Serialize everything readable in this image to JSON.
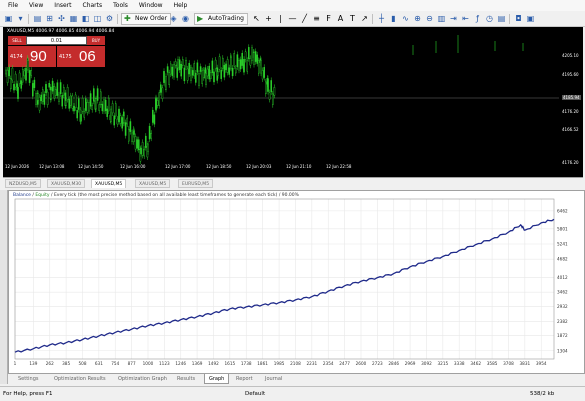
{
  "menu": [
    "File",
    "View",
    "Insert",
    "Charts",
    "Tools",
    "Window",
    "Help"
  ],
  "toolbar": {
    "new_order_label": "New Order",
    "autotrading_label": "AutoTrading"
  },
  "chart": {
    "title": "XAUUSD,M5  4006.97 4006.85 4006.94 4006.84",
    "trade_panel": {
      "sell_label": "SELL",
      "buy_label": "BUY",
      "lot_value": "0.01",
      "sell_small": "4174",
      "sell_big": "90",
      "buy_small": "4175",
      "buy_big": "06"
    },
    "price_labels": [
      "4205.10",
      "4195.60",
      "4185.94",
      "4176.20",
      "4166.52",
      "4176.20"
    ],
    "current_price": "4185.94",
    "time_labels": [
      "12 Jun 2026",
      "12 Jun 13:08",
      "12 Jun 14:50",
      "12 Jun 16:00",
      "12 Jun 17:00",
      "12 Jun 18:50",
      "12 Jun 20:03",
      "12 Jun 21:10",
      "12 Jun 22:58"
    ]
  },
  "symbol_tabs": [
    "NZDUSD,M5",
    "XAUUSD,M30",
    "XAUUSD,M5",
    "XAUUSD,M5",
    "EURUSD,M5"
  ],
  "active_symbol_tab": 2,
  "graph": {
    "legend_balance": "Balance",
    "legend_equity": "Equity",
    "legend_text": "Every tick (the most precise method based on all available least timeframes to generate each tick) / 90.00%",
    "line_color": "#1f2a8a",
    "y_labels": [
      "6462",
      "5801",
      "5241",
      "4682",
      "4012",
      "3462",
      "2932",
      "2382",
      "1872",
      "1304"
    ],
    "x_labels": [
      "1",
      "139",
      "262",
      "385",
      "508",
      "631",
      "754",
      "877",
      "1000",
      "1123",
      "1246",
      "1369",
      "1492",
      "1615",
      "1738",
      "1861",
      "1985",
      "2108",
      "2231",
      "2354",
      "2477",
      "2600",
      "2723",
      "2846",
      "2969",
      "3092",
      "3215",
      "3338",
      "3462",
      "3585",
      "3708",
      "3831",
      "3954"
    ]
  },
  "chart_data": {
    "type": "line",
    "title": "",
    "xlabel": "",
    "ylabel": "",
    "xlim": [
      1,
      4050
    ],
    "ylim": [
      1000,
      6900
    ],
    "series": [
      {
        "name": "Balance",
        "x": [
          1,
          139,
          262,
          385,
          508,
          631,
          754,
          877,
          1000,
          1123,
          1246,
          1369,
          1492,
          1615,
          1738,
          1861,
          1985,
          2108,
          2231,
          2354,
          2477,
          2600,
          2723,
          2846,
          2969,
          3092,
          3215,
          3338,
          3462,
          3585,
          3708,
          3800,
          3831,
          3954,
          4050
        ],
        "values": [
          1250,
          1380,
          1520,
          1600,
          1720,
          1850,
          1980,
          2100,
          2230,
          2330,
          2450,
          2560,
          2700,
          2850,
          2920,
          3000,
          3080,
          3180,
          3300,
          3500,
          3700,
          3870,
          4000,
          4150,
          4400,
          4600,
          4780,
          5000,
          5220,
          5430,
          5680,
          5950,
          5750,
          6020,
          6150
        ]
      }
    ]
  },
  "bottom_tabs": [
    "Settings",
    "Optimization Results",
    "Optimization Graph",
    "Results",
    "Graph",
    "Report",
    "Journal"
  ],
  "active_bottom_tab": 4,
  "status": {
    "help": "For Help, press F1",
    "profile": "Default",
    "traffic": "538/2 kb"
  }
}
